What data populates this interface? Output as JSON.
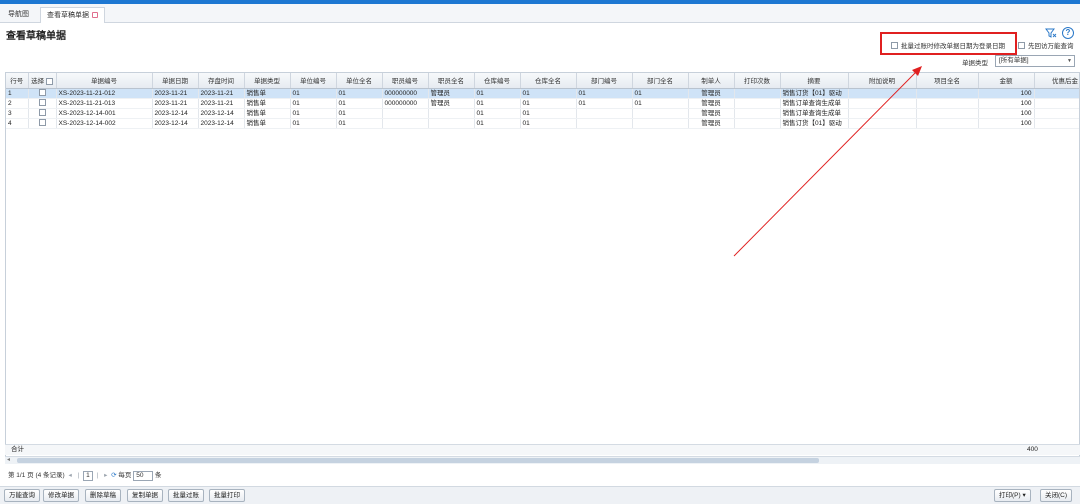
{
  "tabs": [
    {
      "label": "导航图"
    },
    {
      "label": "查看草稿单据"
    }
  ],
  "page": {
    "title": "查看草稿单据"
  },
  "options": {
    "batch_post_date_label": "批量过账时修改单据日期为登录日期",
    "first_query_label": "先回访万能查询"
  },
  "filter": {
    "type_label": "单据类型",
    "type_value": "[所有单据]"
  },
  "table": {
    "columns": [
      "行号",
      "选择",
      "单据编号",
      "单据日期",
      "存盘时间",
      "单据类型",
      "单位编号",
      "单位全名",
      "职员编号",
      "职员全名",
      "仓库编号",
      "仓库全名",
      "部门编号",
      "部门全名",
      "制单人",
      "打印次数",
      "摘要",
      "附加说明",
      "项目全名",
      "金额",
      "优惠后金"
    ],
    "rows": [
      {
        "no": "1",
        "bill_no": "XS-2023-11-21-012",
        "bill_date": "2023-11-21",
        "save_time": "2023-11-21",
        "bill_type": "销售单",
        "unit_no": "01",
        "unit_name": "01",
        "staff_no": "000000000",
        "staff_name": "管理员",
        "wh_no": "01",
        "wh_name": "01",
        "dept_no": "01",
        "dept_name": "01",
        "maker": "管理员",
        "print_count": "",
        "summary": "销售订货【01】驱动",
        "remark": "",
        "project": "",
        "amount": "100",
        "discount": ""
      },
      {
        "no": "2",
        "bill_no": "XS-2023-11-21-013",
        "bill_date": "2023-11-21",
        "save_time": "2023-11-21",
        "bill_type": "销售单",
        "unit_no": "01",
        "unit_name": "01",
        "staff_no": "000000000",
        "staff_name": "管理员",
        "wh_no": "01",
        "wh_name": "01",
        "dept_no": "01",
        "dept_name": "01",
        "maker": "管理员",
        "print_count": "",
        "summary": "销售订单查询生成单",
        "remark": "",
        "project": "",
        "amount": "100",
        "discount": ""
      },
      {
        "no": "3",
        "bill_no": "XS-2023-12-14-001",
        "bill_date": "2023-12-14",
        "save_time": "2023-12-14",
        "bill_type": "销售单",
        "unit_no": "01",
        "unit_name": "01",
        "staff_no": "",
        "staff_name": "",
        "wh_no": "01",
        "wh_name": "01",
        "dept_no": "",
        "dept_name": "",
        "maker": "管理员",
        "print_count": "",
        "summary": "销售订单查询生成单",
        "remark": "",
        "project": "",
        "amount": "100",
        "discount": ""
      },
      {
        "no": "4",
        "bill_no": "XS-2023-12-14-002",
        "bill_date": "2023-12-14",
        "save_time": "2023-12-14",
        "bill_type": "销售单",
        "unit_no": "01",
        "unit_name": "01",
        "staff_no": "",
        "staff_name": "",
        "wh_no": "01",
        "wh_name": "01",
        "dept_no": "",
        "dept_name": "",
        "maker": "管理员",
        "print_count": "",
        "summary": "销售订货【01】驱动",
        "remark": "",
        "project": "",
        "amount": "100",
        "discount": ""
      }
    ],
    "total_label": "合计",
    "total_amount": "400"
  },
  "pager": {
    "info": "第 1/1 页 (4 条记录)",
    "current_page": "1",
    "per_page_label": "每页",
    "per_page_value": "50",
    "unit": "条"
  },
  "footer": {
    "buttons": [
      "万能查询",
      "修改单据",
      "删除草稿",
      "复制单据",
      "批量过账",
      "批量打印"
    ],
    "print_label": "打印(P)",
    "close_label": "关闭(C)"
  },
  "colors": {
    "accent": "#1d77d2",
    "selected_row": "#cfe3f7",
    "annotation": "#e02020"
  },
  "icons": [
    "filter-icon",
    "help-icon",
    "tab-close-icon",
    "dropdown-arrow-icon",
    "refresh-icon"
  ]
}
